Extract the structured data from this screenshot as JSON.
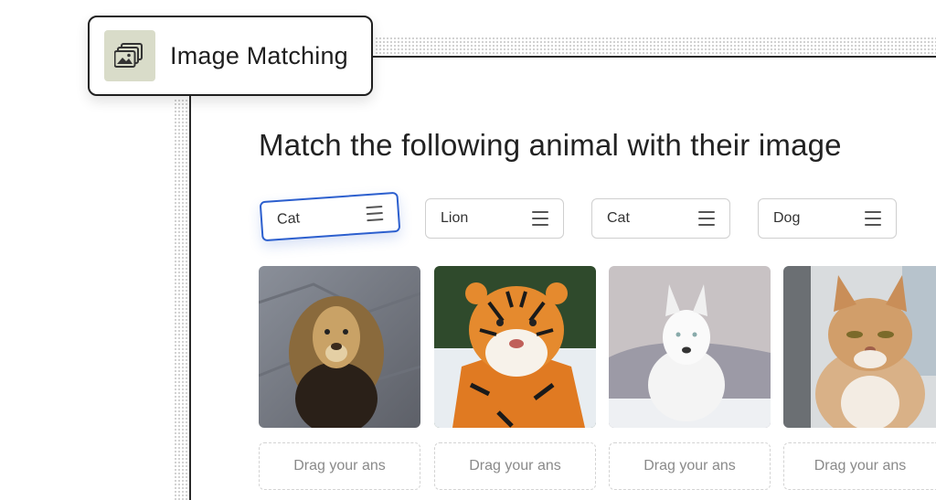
{
  "card": {
    "title": "Image Matching",
    "icon": "image-gallery-icon"
  },
  "question": {
    "heading": "Match the following animal with their image"
  },
  "options": [
    {
      "label": "Cat",
      "state": "dragging"
    },
    {
      "label": "Lion"
    },
    {
      "label": "Cat"
    },
    {
      "label": "Dog"
    }
  ],
  "images": [
    {
      "subject": "lion"
    },
    {
      "subject": "tiger"
    },
    {
      "subject": "white dog"
    },
    {
      "subject": "cat"
    }
  ],
  "drop_zones": [
    {
      "placeholder": "Drag your ans"
    },
    {
      "placeholder": "Drag your ans"
    },
    {
      "placeholder": "Drag your ans"
    },
    {
      "placeholder": "Drag your ans"
    }
  ],
  "colors": {
    "accent": "#2c5fce",
    "icon_bg": "#d9dcc9"
  }
}
